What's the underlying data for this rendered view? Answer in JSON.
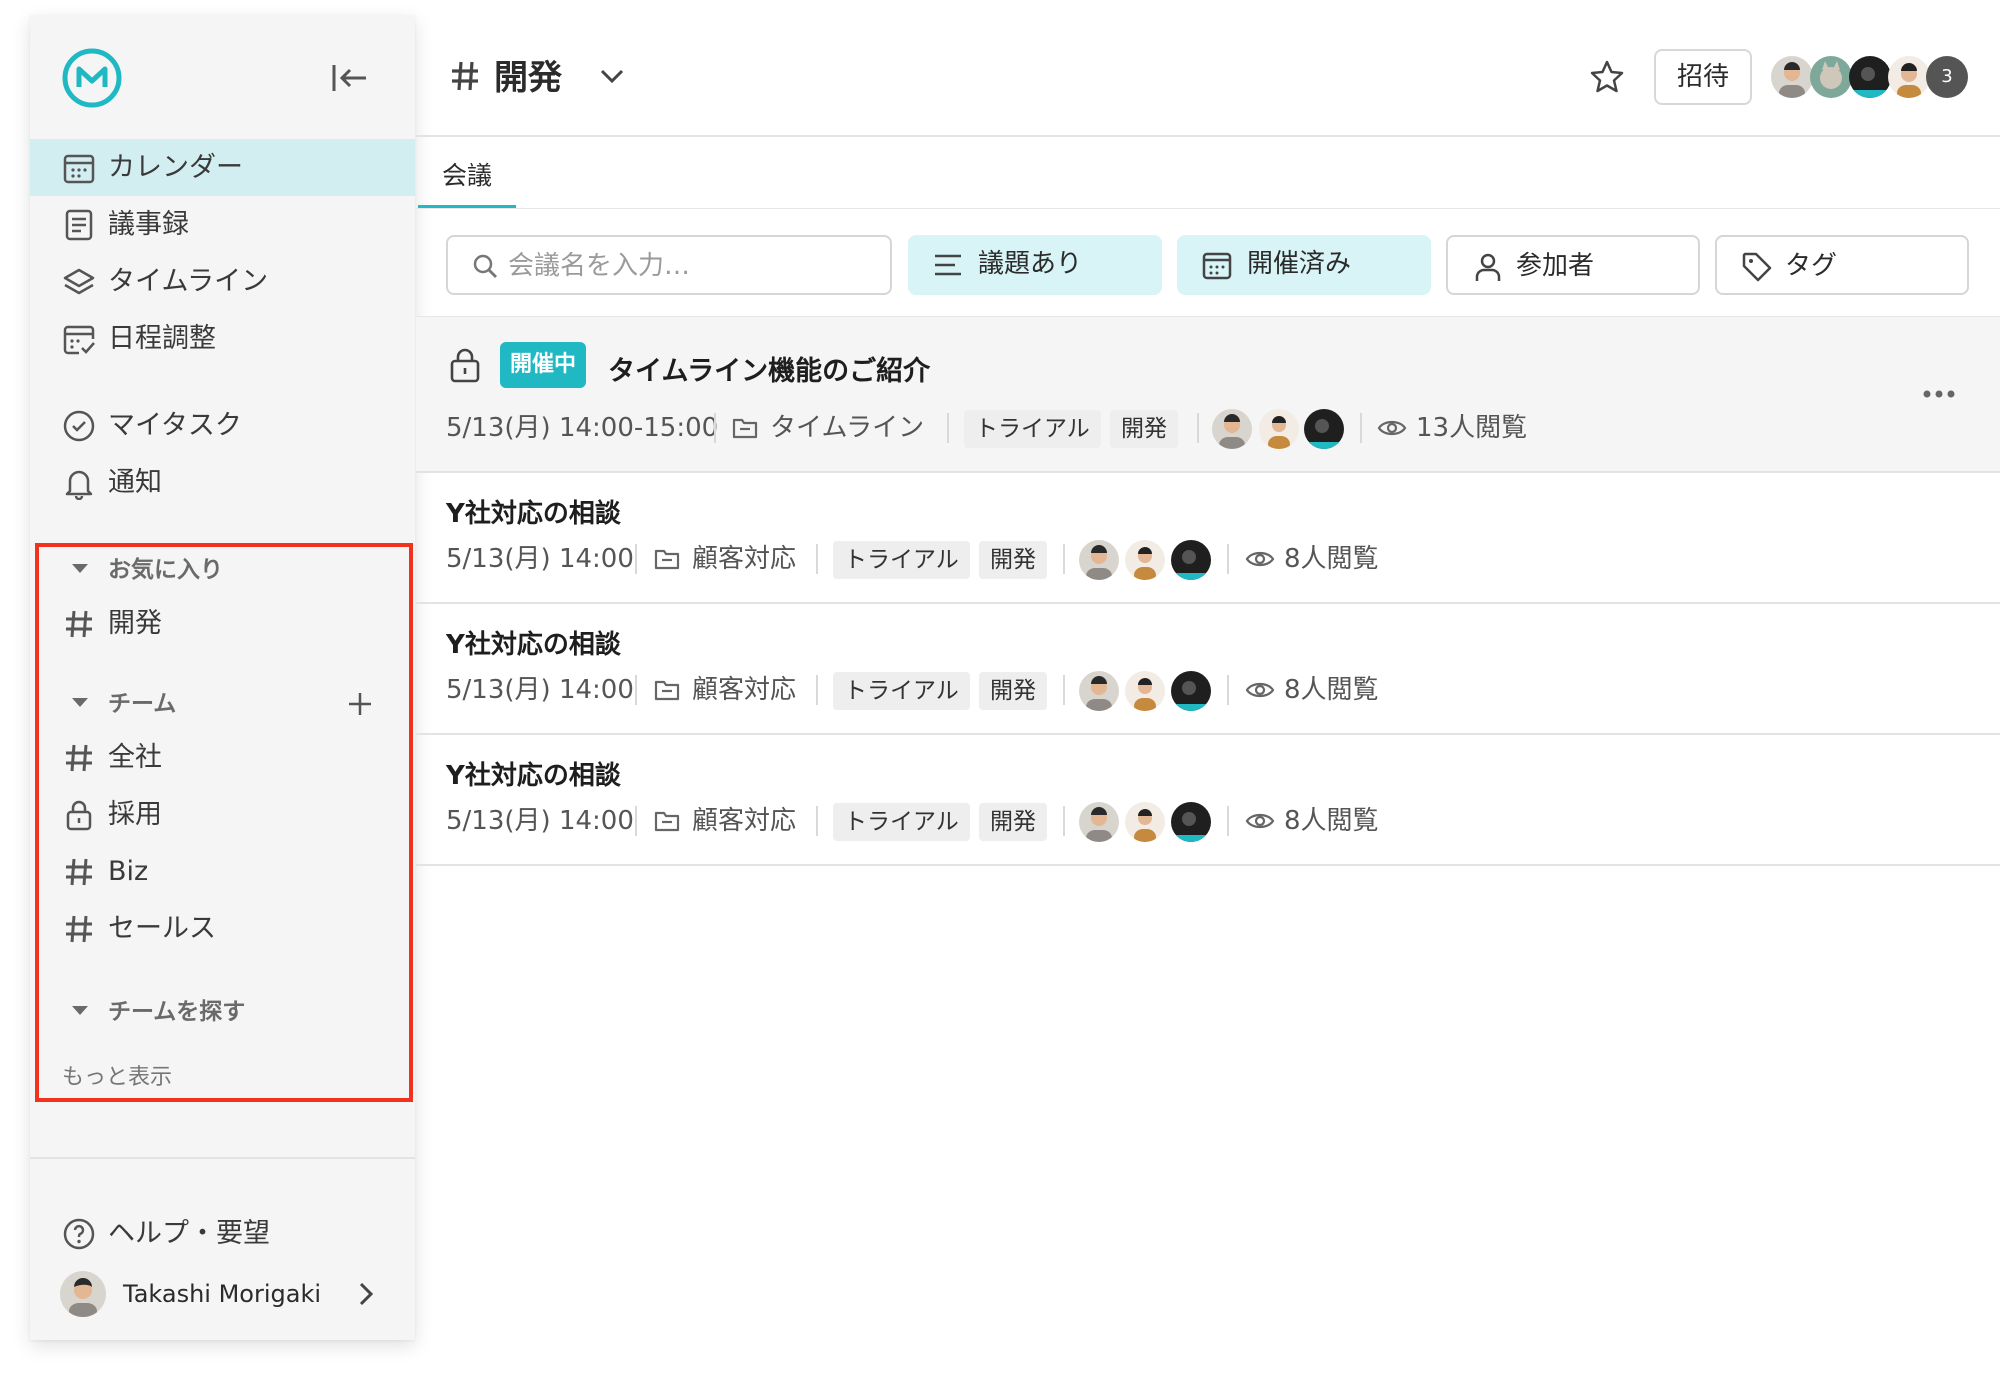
{
  "sidebar": {
    "nav": [
      {
        "label": "カレンダー",
        "icon": "calendar-icon",
        "active": true
      },
      {
        "label": "議事録",
        "icon": "document-icon"
      },
      {
        "label": "タイムライン",
        "icon": "layers-icon"
      },
      {
        "label": "日程調整",
        "icon": "calendar-check-icon"
      }
    ],
    "nav2": [
      {
        "label": "マイタスク",
        "icon": "check-circle-icon"
      },
      {
        "label": "通知",
        "icon": "bell-icon"
      }
    ],
    "favorites": {
      "header": "お気に入り",
      "items": [
        {
          "label": "開発",
          "icon": "hash-icon"
        }
      ]
    },
    "teams": {
      "header": "チーム",
      "items": [
        {
          "label": "全社",
          "icon": "hash-icon"
        },
        {
          "label": "採用",
          "icon": "lock-icon"
        },
        {
          "label": "Biz",
          "icon": "hash-icon"
        },
        {
          "label": "セールス",
          "icon": "hash-icon"
        }
      ]
    },
    "explore": {
      "header": "チームを探す",
      "more": "もっと表示"
    },
    "help": "ヘルプ・要望",
    "user": "Takashi Morigaki"
  },
  "header": {
    "title": "開発",
    "invite": "招待",
    "member_overflow": "3"
  },
  "tabs": [
    {
      "label": "会議"
    }
  ],
  "filters": {
    "search_placeholder": "会議名を入力…",
    "agenda": "議題あり",
    "held": "開催済み",
    "participants": "参加者",
    "tags": "タグ"
  },
  "meetings": [
    {
      "locked": true,
      "badge": "開催中",
      "title": "タイムライン機能のご紹介",
      "datetime": "5/13(月) 14:00-15:00",
      "folder": "タイムライン",
      "tags": [
        "トライアル",
        "開発"
      ],
      "views": "13人閲覧"
    },
    {
      "title": "Y社対応の相談",
      "datetime": "5/13(月) 14:00",
      "folder": "顧客対応",
      "tags": [
        "トライアル",
        "開発"
      ],
      "views": "8人閲覧"
    },
    {
      "title": "Y社対応の相談",
      "datetime": "5/13(月) 14:00",
      "folder": "顧客対応",
      "tags": [
        "トライアル",
        "開発"
      ],
      "views": "8人閲覧"
    },
    {
      "title": "Y社対応の相談",
      "datetime": "5/13(月) 14:00",
      "folder": "顧客対応",
      "tags": [
        "トライアル",
        "開発"
      ],
      "views": "8人閲覧"
    }
  ],
  "colors": {
    "accent": "#1fb8c3",
    "active_nav": "#d3eef1",
    "filter_fill": "#d8f4f7",
    "highlight": "#f0321e"
  }
}
